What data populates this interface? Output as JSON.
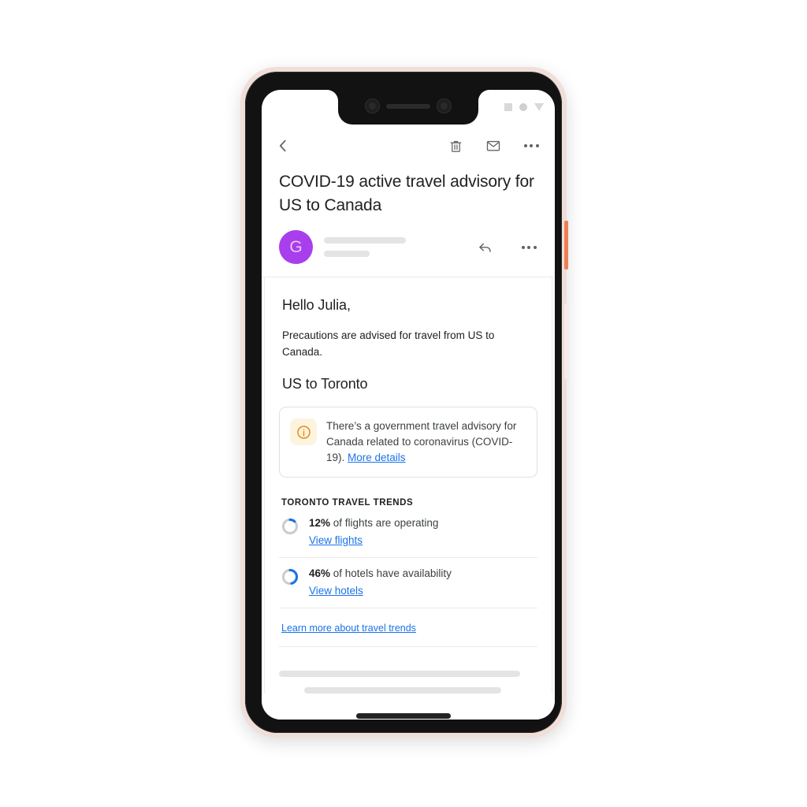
{
  "device": {
    "frame_color": "#f0ded8",
    "bezel_color": "#121212",
    "power_button_color": "#ee7f55",
    "volume_button_color": "#f7ece8"
  },
  "statusbar": {
    "icons": [
      "square-placeholder-icon",
      "circle-placeholder-icon",
      "triangle-placeholder-icon"
    ]
  },
  "toolbar": {
    "back_label": "‹",
    "delete_icon": "trash-icon",
    "unread_icon": "envelope-icon",
    "overflow_icon": "more-options-icon"
  },
  "email": {
    "subject": "COVID-19 active travel advisory for US to Canada",
    "avatar_letter": "G",
    "avatar_color": "#a93eec",
    "reply_icon": "reply-arrow-icon",
    "overflow_icon": "more-options-icon",
    "greeting": "Hello Julia,",
    "paragraph": "Precautions are advised for travel from US to Canada.",
    "route_heading": "US to Toronto"
  },
  "advisory": {
    "icon": "info-circle-icon",
    "icon_color": "#e8890c",
    "icon_bg": "#fdf4e0",
    "text": "There’s a government travel advisory for Canada related to coronavirus (COVID-19). ",
    "link_label": "More details"
  },
  "trends": {
    "title": "TORONTO TRAVEL TRENDS",
    "accent_color": "#1a73e8",
    "track_color": "#c9ccd0",
    "rows": [
      {
        "percent_label": "12%",
        "percent_value": 12,
        "text": " of flights are operating",
        "link_label": "View flights",
        "donut_name": "flights-donut-chart"
      },
      {
        "percent_label": "46%",
        "percent_value": 46,
        "text": " of hotels have availability",
        "link_label": "View hotels",
        "donut_name": "hotels-donut-chart"
      }
    ],
    "learn_more_label": "Learn more about travel trends"
  },
  "chart_data": [
    {
      "type": "pie",
      "title": "12% of flights are operating",
      "labels": [
        "Operating",
        "Not operating"
      ],
      "values": [
        12,
        88
      ],
      "colors": [
        "#1a73e8",
        "#c9ccd0"
      ],
      "legend": "none"
    },
    {
      "type": "pie",
      "title": "46% of hotels have availability",
      "labels": [
        "Available",
        "Unavailable"
      ],
      "values": [
        46,
        54
      ],
      "colors": [
        "#1a73e8",
        "#c9ccd0"
      ],
      "legend": "none"
    }
  ]
}
